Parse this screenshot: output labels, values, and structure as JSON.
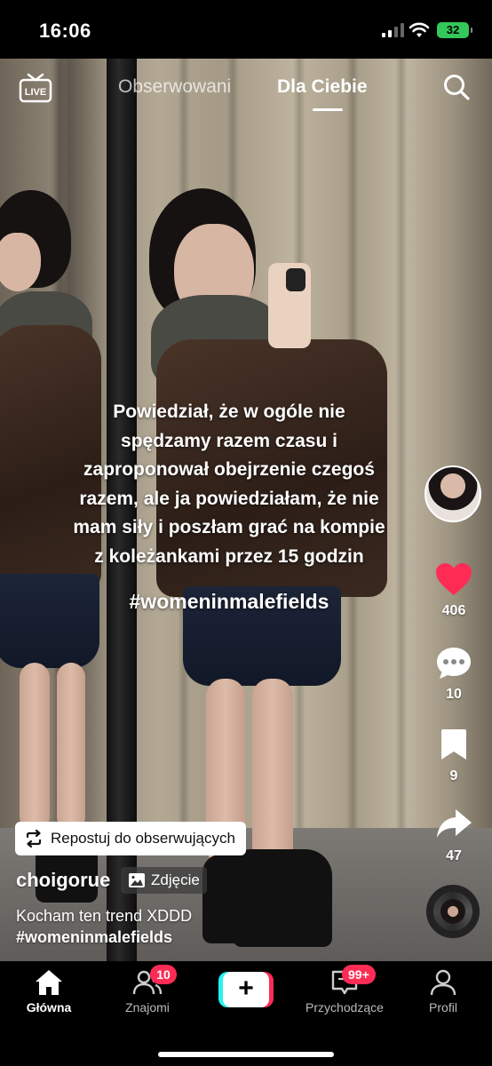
{
  "status_bar": {
    "time": "16:06",
    "battery": "32"
  },
  "top_nav": {
    "tabs": [
      {
        "label": "Obserwowani",
        "active": false
      },
      {
        "label": "Dla Ciebie",
        "active": true
      }
    ],
    "live_icon": "live-icon",
    "search_icon": "search-icon"
  },
  "overlay": {
    "lines": [
      "Powiedział, że w ogóle nie",
      "spędzamy razem czasu i",
      "zaproponował obejrzenie czegoś",
      "razem, ale ja powiedziałam, że nie",
      "mam siły i poszłam grać na kompie",
      "z koleżankami przez 15 godzin"
    ],
    "hashtag": "#womeninmalefields"
  },
  "actions": {
    "likes": "406",
    "comments": "10",
    "bookmarks": "9",
    "shares": "47",
    "like_color": "#fe2c55"
  },
  "post": {
    "repost_label": "Repostuj do obserwujących",
    "author": "choigorue",
    "photo_badge": "Zdjęcie",
    "description": "Kocham ten trend XDDD",
    "description_tag": "#womeninmalefields"
  },
  "bottom_nav": {
    "home": "Główna",
    "friends": "Znajomi",
    "friends_badge": "10",
    "create": "+",
    "inbox": "Przychodzące",
    "inbox_badge": "99+",
    "profile": "Profil"
  },
  "colors": {
    "accent": "#fe2c55",
    "cyan": "#25f4ee",
    "battery": "#34c759"
  }
}
